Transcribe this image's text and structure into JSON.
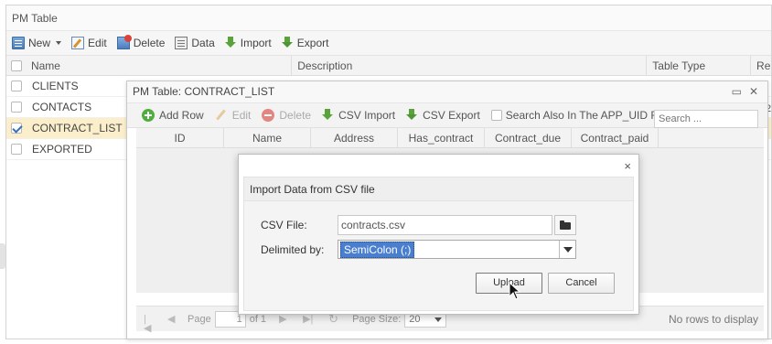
{
  "main_window": {
    "title": "PM Table",
    "toolbar": {
      "new": "New",
      "edit": "Edit",
      "delete": "Delete",
      "data": "Data",
      "import": "Import",
      "export": "Export"
    },
    "columns": [
      "Name",
      "Description",
      "Table Type",
      "Re"
    ],
    "rows": [
      {
        "name": "CLIENTS",
        "checked": false
      },
      {
        "name": "CONTACTS",
        "checked": false
      },
      {
        "name": "CONTRACT_LIST",
        "checked": true
      },
      {
        "name": "EXPORTED",
        "checked": false
      }
    ],
    "peek_value": "2"
  },
  "pm_panel": {
    "title": "PM Table: CONTRACT_LIST",
    "toolbar": {
      "add_row": "Add Row",
      "edit": "Edit",
      "delete": "Delete",
      "csv_import": "CSV Import",
      "csv_export": "CSV Export",
      "search_also_label": "Search Also In The APP_UID Field",
      "search_placeholder": "Search ..."
    },
    "columns": [
      "ID",
      "Name",
      "Address",
      "Has_contract",
      "Contract_due",
      "Contract_paid"
    ],
    "pager": {
      "page_label": "Page",
      "page_value": "1",
      "of_label": "of 1",
      "page_size_label": "Page Size:",
      "page_size_value": "20",
      "empty_message": "No rows to display"
    }
  },
  "import_dialog": {
    "close_symbol": "×",
    "heading": "Import Data from CSV file",
    "csv_file_label": "CSV File:",
    "csv_file_value": "contracts.csv",
    "delimiter_label": "Delimited by:",
    "delimiter_value": "SemiColon (;)",
    "upload_label": "Upload",
    "cancel_label": "Cancel"
  },
  "colors": {
    "selected_row": "#fbefcb",
    "selection_highlight": "#4a7fd0",
    "add_icon": "#4fae3d",
    "delete_icon": "#e06a64"
  }
}
